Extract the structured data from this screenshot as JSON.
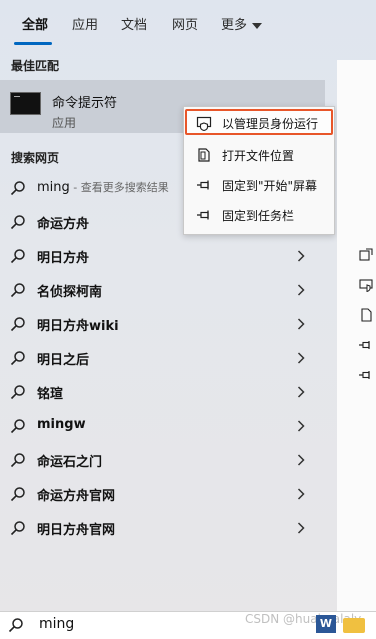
{
  "tabs": [
    {
      "label": "全部"
    },
    {
      "label": "应用"
    },
    {
      "label": "文档"
    },
    {
      "label": "网页"
    },
    {
      "label": "更多"
    }
  ],
  "best_match": {
    "section_label": "最佳匹配",
    "app_name": "命令提示符",
    "app_type": "应用"
  },
  "web_search": {
    "section_label": "搜索网页",
    "first": {
      "query": "ming",
      "hint": " - 查看更多搜索结果"
    },
    "results": [
      "命运方舟",
      "明日方舟",
      "名侦探柯南",
      "明日方舟wiki",
      "明日之后",
      "铭瑄",
      "mingw",
      "命运石之门",
      "命运方舟官网",
      "明日方舟官网"
    ]
  },
  "context_menu": {
    "items": [
      {
        "label": "以管理员身份运行",
        "icon": "shield-icon"
      },
      {
        "label": "打开文件位置",
        "icon": "folder-icon"
      },
      {
        "label": "固定到\"开始\"屏幕",
        "icon": "pin-icon"
      },
      {
        "label": "固定到任务栏",
        "icon": "pin-icon"
      }
    ],
    "highlight_color": "#e8562a"
  },
  "search": {
    "value": "ming"
  },
  "watermark": "CSDN @huahualaly",
  "taskbar": {
    "word_label": "W"
  },
  "colors": {
    "accent": "#0067c0"
  }
}
